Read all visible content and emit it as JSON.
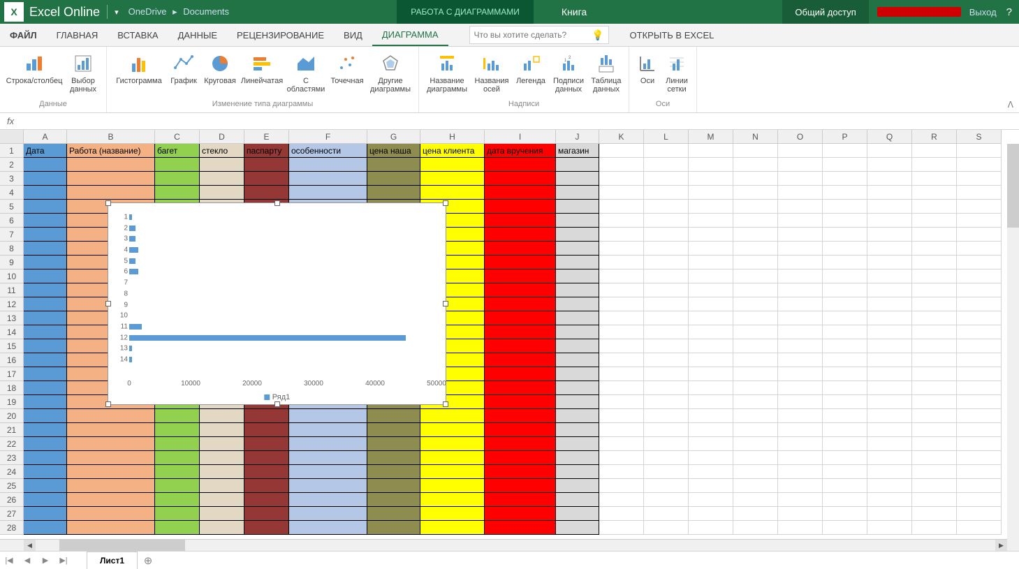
{
  "app": {
    "name": "Excel Online",
    "logo_letter": "X"
  },
  "breadcrumb": {
    "root": "OneDrive",
    "folder": "Documents"
  },
  "context_tab": "РАБОТА С ДИАГРАММАМИ",
  "doc_name": "Книга",
  "share_label": "Общий доступ",
  "signout_label": "Выход",
  "tabs": {
    "file": "ФАЙЛ",
    "home": "ГЛАВНАЯ",
    "insert": "ВСТАВКА",
    "data": "ДАННЫЕ",
    "review": "РЕЦЕНЗИРОВАНИЕ",
    "view": "ВИД",
    "chart": "ДИАГРАММА"
  },
  "tellme_placeholder": "Что вы хотите сделать?",
  "open_in_excel": "ОТКРЫТЬ В EXCEL",
  "ribbon": {
    "data": {
      "label": "Данные",
      "switch": "Строка/столбец",
      "select": "Выбор данных"
    },
    "change_type": {
      "label": "Изменение типа диаграммы",
      "hist": "Гистограмма",
      "line": "График",
      "pie": "Круговая",
      "bar": "Линейчатая",
      "area": "С областями",
      "scatter": "Точечная",
      "other": "Другие диаграммы"
    },
    "labels": {
      "label": "Надписи",
      "title": "Название диаграммы",
      "axes_t": "Названия осей",
      "legend": "Легенда",
      "datalbl": "Подписи данных",
      "table": "Таблица данных"
    },
    "axes": {
      "label": "Оси",
      "axes": "Оси",
      "grid": "Линии сетки"
    }
  },
  "formula_fx": "fx",
  "columns": [
    "A",
    "B",
    "C",
    "D",
    "E",
    "F",
    "G",
    "H",
    "I",
    "J",
    "K",
    "L",
    "M",
    "N",
    "O",
    "P",
    "Q",
    "R",
    "S"
  ],
  "headers": {
    "A": "Дата",
    "B": "Работа (название)",
    "C": "багет",
    "D": "стекло",
    "E": "паспарту",
    "F": "особенности",
    "G": "цена наша",
    "H": "цена клиента",
    "I": "дата вручения",
    "J": "магазин"
  },
  "row_count": 28,
  "sheet_name": "Лист1",
  "chart_data": {
    "type": "bar",
    "categories": [
      "1",
      "2",
      "3",
      "4",
      "5",
      "6",
      "7",
      "8",
      "9",
      "10",
      "11",
      "12",
      "13",
      "14"
    ],
    "values": [
      500,
      1000,
      1000,
      1500,
      1000,
      1500,
      0,
      0,
      0,
      0,
      2000,
      45000,
      500,
      500
    ],
    "series_name": "Ряд1",
    "xlim": [
      0,
      50000
    ],
    "xticks": [
      0,
      10000,
      20000,
      30000,
      40000,
      50000
    ]
  }
}
